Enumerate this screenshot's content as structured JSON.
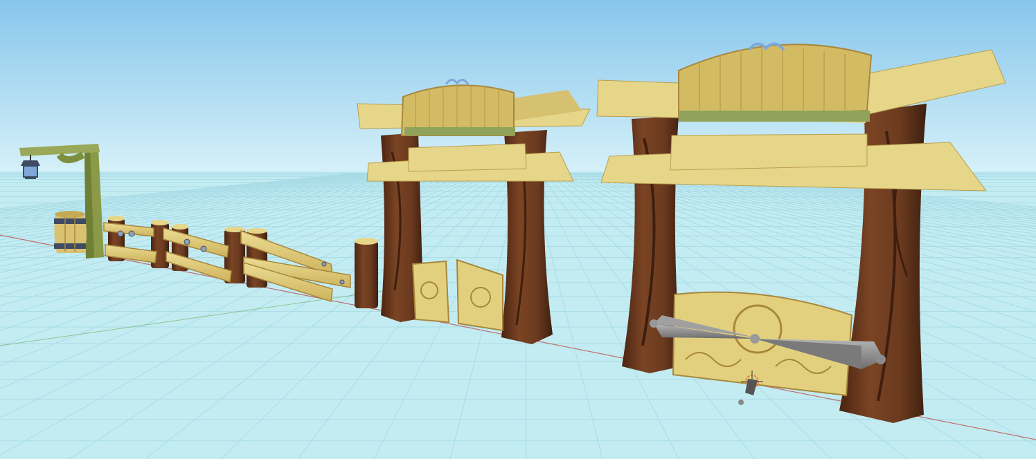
{
  "scene": {
    "objects": [
      {
        "id": "lantern-post",
        "kind": "prop"
      },
      {
        "id": "barrel",
        "kind": "prop"
      },
      {
        "id": "rail-fence",
        "kind": "prop"
      },
      {
        "id": "stump",
        "kind": "prop"
      },
      {
        "id": "small-gate",
        "kind": "prop"
      },
      {
        "id": "large-gate",
        "kind": "prop"
      },
      {
        "id": "rotation-gizmo",
        "kind": "editor-gizmo"
      },
      {
        "id": "object-pivot",
        "kind": "editor-gizmo"
      }
    ]
  },
  "colors": {
    "sky_top": "#87c6ec",
    "sky_bottom": "#d6f1f8",
    "ground": "#c3ecf2",
    "grid": "#a7dbe6",
    "trunk": "#6b3a1f",
    "trunk_dark": "#4a2412",
    "wood_light": "#e6d68a",
    "wood_mid": "#d2bb63",
    "wood_dark": "#a7873d",
    "moss": "#9ab15a",
    "iron": "#3e4b63",
    "gizmo": "#8c8c8c",
    "axis_red": "#c0504d",
    "axis_green": "#6aa84f"
  }
}
